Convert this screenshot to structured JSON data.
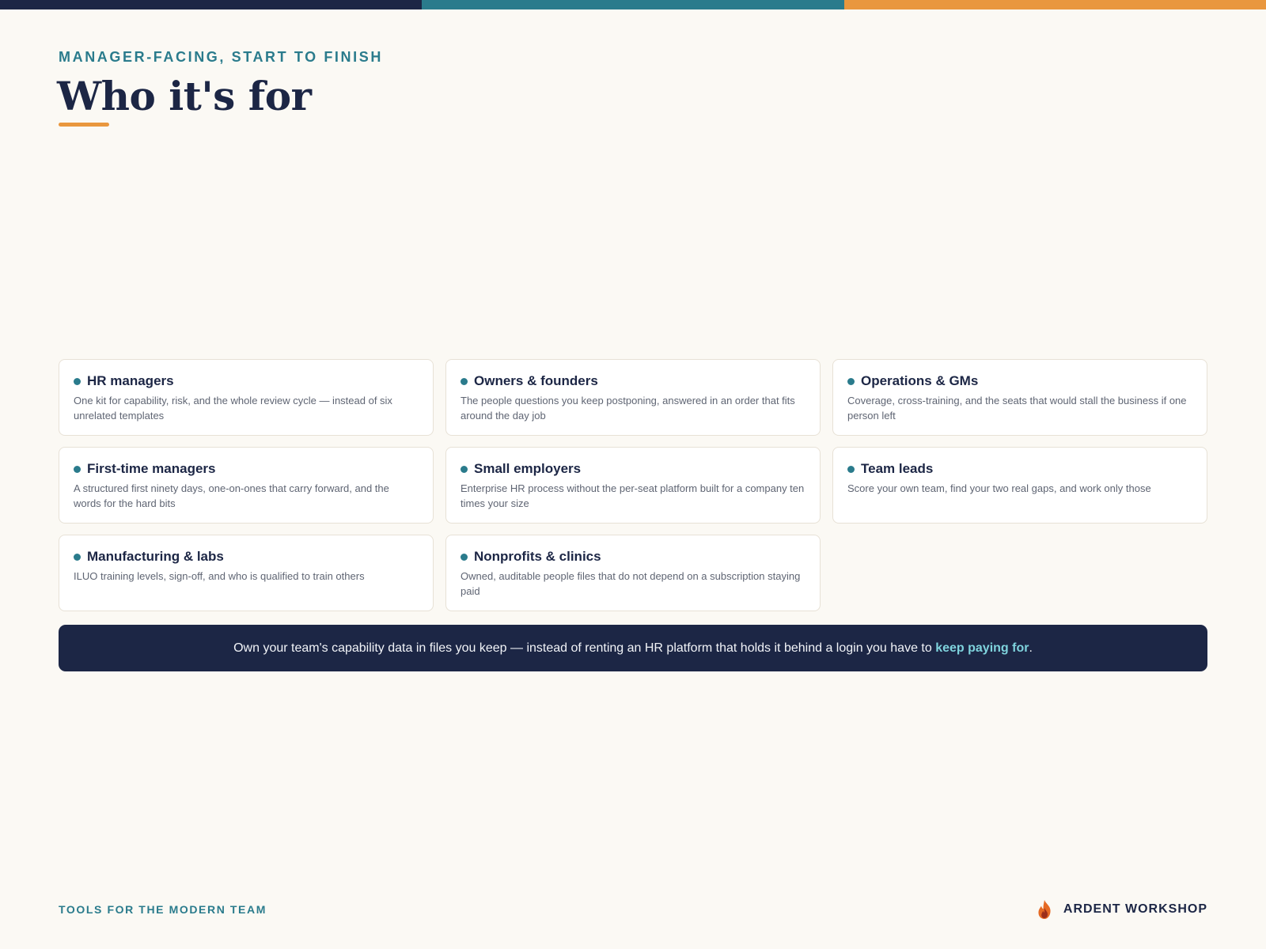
{
  "colors": {
    "navy": "#1c2645",
    "teal": "#2a7b8c",
    "orange": "#e9973e",
    "background": "#fbf9f4",
    "highlight": "#7fd3dd"
  },
  "header": {
    "eyebrow": "MANAGER-FACING, START TO FINISH",
    "title": "Who it's for"
  },
  "audiences": [
    {
      "title": "HR managers",
      "description": "One kit for capability, risk, and the whole review cycle — instead of six unrelated templates"
    },
    {
      "title": "Owners & founders",
      "description": "The people questions you keep postponing, answered in an order that fits around the day job"
    },
    {
      "title": "Operations & GMs",
      "description": "Coverage, cross-training, and the seats that would stall the business if one person left"
    },
    {
      "title": "First-time managers",
      "description": "A structured first ninety days, one-on-ones that carry forward, and the words for the hard bits"
    },
    {
      "title": "Small employers",
      "description": "Enterprise HR process without the per-seat platform built for a company ten times your size"
    },
    {
      "title": "Team leads",
      "description": "Score your own team, find your two real gaps, and work only those"
    },
    {
      "title": "Manufacturing & labs",
      "description": "ILUO training levels, sign-off, and who is qualified to train others"
    },
    {
      "title": "Nonprofits & clinics",
      "description": "Owned, auditable people files that do not depend on a subscription staying paid"
    }
  ],
  "banner": {
    "text": "Own your team's capability data in files you keep — instead of renting an HR platform that holds it behind a login you have to ",
    "highlight": "keep paying for",
    "end": "."
  },
  "footer": {
    "tagline": "TOOLS FOR THE MODERN TEAM",
    "brand": "ARDENT WORKSHOP",
    "logo_icon": "flame-icon"
  }
}
